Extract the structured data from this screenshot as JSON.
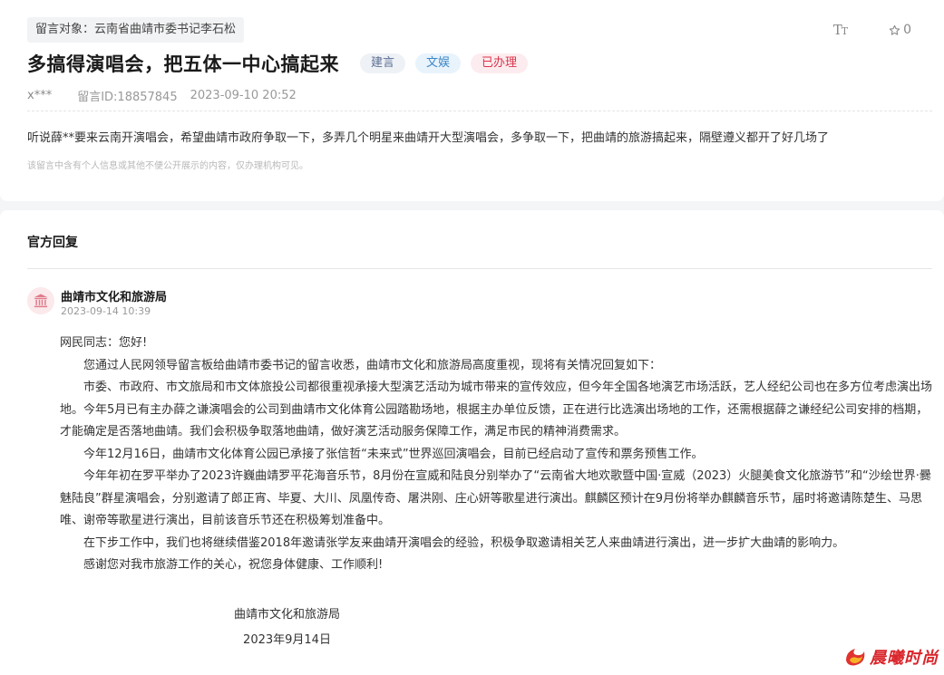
{
  "message": {
    "target": "留言对象：云南省曲靖市委书记李石松",
    "font_tool_large": "T",
    "font_tool_small": "T",
    "favorite_count": "0",
    "title": "多搞得演唱会，把五体一中心搞起来",
    "badges": [
      "建言",
      "文娱",
      "已办理"
    ],
    "author": "x***",
    "message_id": "留言ID:18857845",
    "datetime": "2023-09-10 20:52",
    "content": "听说薛**要来云南开演唱会，希望曲靖市政府争取一下，多弄几个明星来曲靖开大型演唱会，多争取一下，把曲靖的旅游搞起来，隔壁遵义都开了好几场了",
    "privacy_note": "该留言中含有个人信息或其他不便公开展示的内容，仅办理机构可见。"
  },
  "reply": {
    "section_title": "官方回复",
    "org_name": "曲靖市文化和旅游局",
    "date": "2023-09-14 10:39",
    "greeting": "网民同志：您好!",
    "paragraphs": [
      "您通过人民网领导留言板给曲靖市委书记的留言收悉，曲靖市文化和旅游局高度重视，现将有关情况回复如下：",
      "市委、市政府、市文旅局和市文体旅投公司都很重视承接大型演艺活动为城市带来的宣传效应，但今年全国各地演艺市场活跃，艺人经纪公司也在多方位考虑演出场地。今年5月已有主办薛之谦演唱会的公司到曲靖市文化体育公园踏勘场地，根据主办单位反馈，正在进行比选演出场地的工作，还需根据薛之谦经纪公司安排的档期，才能确定是否落地曲靖。我们会积极争取落地曲靖，做好演艺活动服务保障工作，满足市民的精神消费需求。",
      "今年12月16日，曲靖市文化体育公园已承接了张信哲“未来式”世界巡回演唱会，目前已经启动了宣传和票务预售工作。",
      "今年年初在罗平举办了2023许巍曲靖罗平花海音乐节，8月份在宣威和陆良分别举办了“云南省大地欢歌暨中国·宣威（2023）火腿美食文化旅游节”和“沙绘世界·爨魅陆良”群星演唱会，分别邀请了郎正宵、毕夏、大川、凤凰传奇、屠洪刚、庄心妍等歌星进行演出。麒麟区预计在9月份将举办麒麟音乐节，届时将邀请陈楚生、马思唯、谢帝等歌星进行演出，目前该音乐节还在积极筹划准备中。",
      "在下步工作中，我们也将继续借鉴2018年邀请张学友来曲靖开演唱会的经验，积极争取邀请相关艺人来曲靖进行演出，进一步扩大曲靖的影响力。",
      "感谢您对我市旅游工作的关心，祝您身体健康、工作顺利!"
    ],
    "signature_org": "曲靖市文化和旅游局",
    "signature_date": "2023年9月14日"
  },
  "watermark": {
    "text": "晨曦时尚"
  },
  "colors": {
    "title": "#1a1a1a",
    "badge_advice": "#5b6f94",
    "badge_culture": "#3d86c6",
    "badge_handled": "#d9344a",
    "avatar_bg": "#fbe9ec",
    "avatar_icon": "#e07b8a"
  },
  "icons": {
    "font_size": "font-size-icon",
    "favorite": "star-icon",
    "org": "government-building-icon",
    "watermark": "flame-logo-icon"
  }
}
